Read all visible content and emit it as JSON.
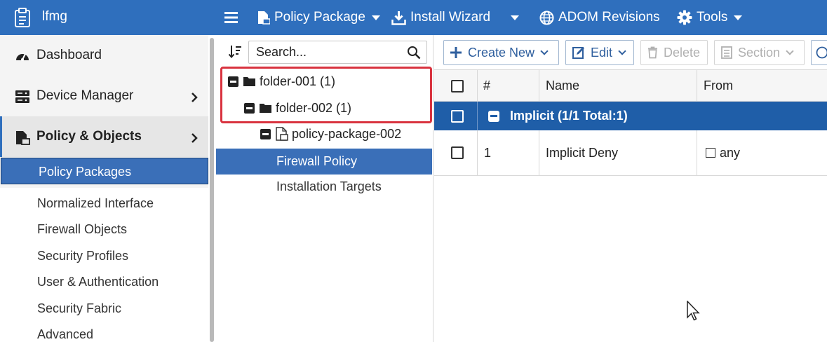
{
  "topbar": {
    "app_title": "lfmg",
    "menus": [
      {
        "label": "Policy Package",
        "icon": "policy-package-icon",
        "has_caret": true
      },
      {
        "label": "Install Wizard",
        "icon": "install-icon",
        "has_caret": true
      },
      {
        "label": "ADOM Revisions",
        "icon": "globe-icon",
        "has_caret": false
      },
      {
        "label": "Tools",
        "icon": "gear-icon",
        "has_caret": true
      }
    ],
    "bg_color": "#2f6fbd"
  },
  "sidebar": {
    "items": [
      {
        "label": "Dashboard",
        "icon": "dashboard-icon"
      },
      {
        "label": "Device Manager",
        "icon": "device-manager-icon"
      },
      {
        "label": "Policy & Objects",
        "icon": "policy-objects-icon"
      }
    ],
    "subitems": [
      {
        "label": "Policy Packages",
        "selected": true
      },
      {
        "label": "Normalized Interface"
      },
      {
        "label": "Firewall Objects"
      },
      {
        "label": "Security Profiles"
      },
      {
        "label": "User & Authentication"
      },
      {
        "label": "Security Fabric"
      },
      {
        "label": "Advanced"
      }
    ]
  },
  "tree": {
    "search_placeholder": "Search...",
    "nodes": [
      {
        "label": "folder-001 (1)",
        "type": "folder"
      },
      {
        "label": "folder-002 (1)",
        "type": "folder"
      },
      {
        "label": "policy-package-002",
        "type": "package"
      },
      {
        "label": "Firewall Policy",
        "selected": true
      },
      {
        "label": "Installation Targets"
      }
    ],
    "highlight_color": "#d9333f"
  },
  "toolbar": {
    "create_new": "Create New",
    "edit": "Edit",
    "delete": "Delete",
    "section": "Section"
  },
  "table": {
    "columns": [
      "#",
      "Name",
      "From"
    ],
    "group": {
      "label": "Implicit (1/1 Total:1)"
    },
    "rows": [
      {
        "num": "1",
        "name": "Implicit Deny",
        "from": "any"
      }
    ]
  }
}
